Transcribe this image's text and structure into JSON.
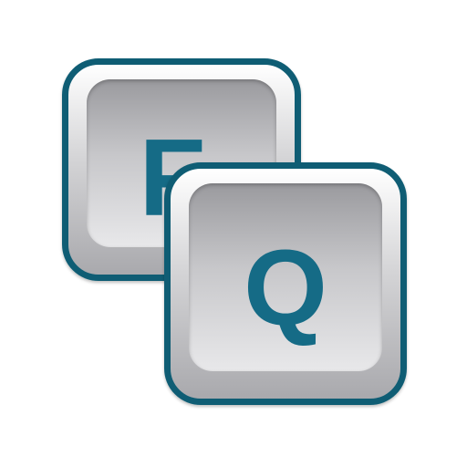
{
  "icon": {
    "back_key": {
      "glyph": "F"
    },
    "front_key": {
      "glyph": "Q"
    },
    "colors": {
      "border": "#0f5d74",
      "glyph": "#156b86",
      "keycap_light": "#ffffff",
      "keycap_dark": "#a9a9ad"
    }
  }
}
